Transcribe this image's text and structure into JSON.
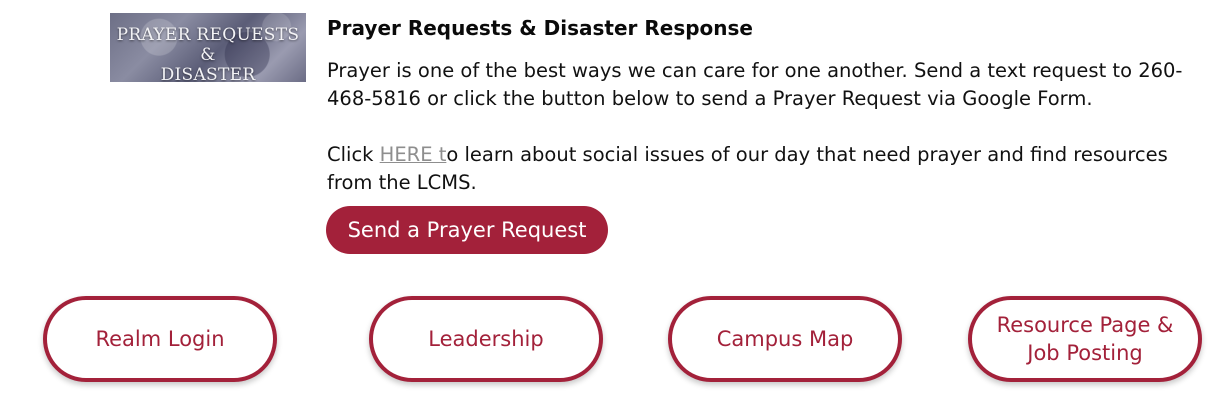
{
  "banner": {
    "image_text_line1": "PRAYER REQUESTS &",
    "image_text_line2": "DISASTER RESPONSE"
  },
  "section": {
    "title": "Prayer Requests & Disaster Response",
    "paragraph1": "Prayer is one of the best ways we can care for one another. Send a text request to 260-468-5816 or click the button below to send a Prayer Request via Google Form.",
    "paragraph2_prefix": "Click ",
    "paragraph2_link": "HERE t",
    "paragraph2_suffix": "o learn about social issues of our day that need prayer and find resources from the LCMS.",
    "button_label": "Send a Prayer Request"
  },
  "quick_links": [
    {
      "label": "Realm Login"
    },
    {
      "label": "Leadership"
    },
    {
      "label": "Campus Map"
    },
    {
      "label": "Resource Page & Job Posting"
    }
  ],
  "colors": {
    "accent": "#a3213a",
    "link": "#8e8e8e",
    "text": "#111111"
  }
}
